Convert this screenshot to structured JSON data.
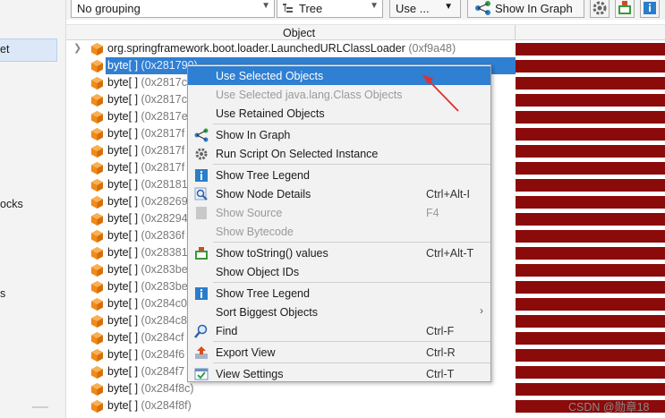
{
  "sidebar": {
    "items": [
      {
        "label": "et"
      },
      {
        "label": "ocks"
      },
      {
        "label": "s"
      }
    ]
  },
  "toolbar": {
    "grouping": "No grouping",
    "view_mode": "Tree",
    "use_button": "Use ...",
    "show_in_graph": "Show In Graph",
    "icons": [
      "settings-gear-icon",
      "export-icon",
      "info-icon"
    ]
  },
  "table": {
    "column_header": "Object",
    "root_row": {
      "name": "org.springframework.boot.loader.LaunchedURLClassLoader",
      "addr": "(0xf9a48)"
    },
    "rows": [
      {
        "name": "byte[ ]",
        "addr": "(0x281790)",
        "selected": true
      },
      {
        "name": "byte[ ]",
        "addr": "(0x2817c"
      },
      {
        "name": "byte[ ]",
        "addr": "(0x2817c"
      },
      {
        "name": "byte[ ]",
        "addr": "(0x2817e"
      },
      {
        "name": "byte[ ]",
        "addr": "(0x2817f"
      },
      {
        "name": "byte[ ]",
        "addr": "(0x2817f"
      },
      {
        "name": "byte[ ]",
        "addr": "(0x2817f"
      },
      {
        "name": "byte[ ]",
        "addr": "(0x28181"
      },
      {
        "name": "byte[ ]",
        "addr": "(0x28269"
      },
      {
        "name": "byte[ ]",
        "addr": "(0x28294"
      },
      {
        "name": "byte[ ]",
        "addr": "(0x2836f"
      },
      {
        "name": "byte[ ]",
        "addr": "(0x28381"
      },
      {
        "name": "byte[ ]",
        "addr": "(0x283be"
      },
      {
        "name": "byte[ ]",
        "addr": "(0x283be"
      },
      {
        "name": "byte[ ]",
        "addr": "(0x284c0"
      },
      {
        "name": "byte[ ]",
        "addr": "(0x284c8"
      },
      {
        "name": "byte[ ]",
        "addr": "(0x284cf"
      },
      {
        "name": "byte[ ]",
        "addr": "(0x284f6"
      },
      {
        "name": "byte[ ]",
        "addr": "(0x284f7"
      },
      {
        "name": "byte[ ]",
        "addr": "(0x284f8c)"
      },
      {
        "name": "byte[ ]",
        "addr": "(0x284f8f)"
      }
    ],
    "bar_color": "#8b0a0a",
    "selection_color": "#2f7fd2"
  },
  "context_menu": {
    "items": [
      {
        "label": "Use Selected Objects",
        "highlight": true,
        "icon": ""
      },
      {
        "label": "Use Selected java.lang.Class Objects",
        "disabled": true,
        "icon": ""
      },
      {
        "label": "Use Retained Objects",
        "icon": ""
      },
      {
        "label": "Show In Graph",
        "icon": "graph-icon"
      },
      {
        "label": "Run Script On Selected Instance",
        "icon": "gear-icon"
      },
      {
        "label": "Show Tree Legend",
        "icon": "info-icon"
      },
      {
        "label": "Show Node Details",
        "shortcut": "Ctrl+Alt-I",
        "icon": "magnifier-icon"
      },
      {
        "label": "Show Source",
        "shortcut": "F4",
        "disabled": true,
        "icon": "source-icon"
      },
      {
        "label": "Show Bytecode",
        "disabled": true,
        "icon": ""
      },
      {
        "label": "Show toString() values",
        "shortcut": "Ctrl+Alt-T",
        "icon": "tostring-icon"
      },
      {
        "label": "Show Object IDs",
        "icon": ""
      },
      {
        "label": "Show Tree Legend",
        "icon": "info-icon"
      },
      {
        "label": "Sort Biggest Objects",
        "submenu": true,
        "icon": ""
      },
      {
        "label": "Find",
        "shortcut": "Ctrl-F",
        "icon": "find-icon"
      },
      {
        "label": "Export View",
        "shortcut": "Ctrl-R",
        "icon": "export-icon"
      },
      {
        "label": "View Settings",
        "shortcut": "Ctrl-T",
        "icon": "view-settings-icon"
      }
    ]
  },
  "watermark": "CSDN @勋章18"
}
